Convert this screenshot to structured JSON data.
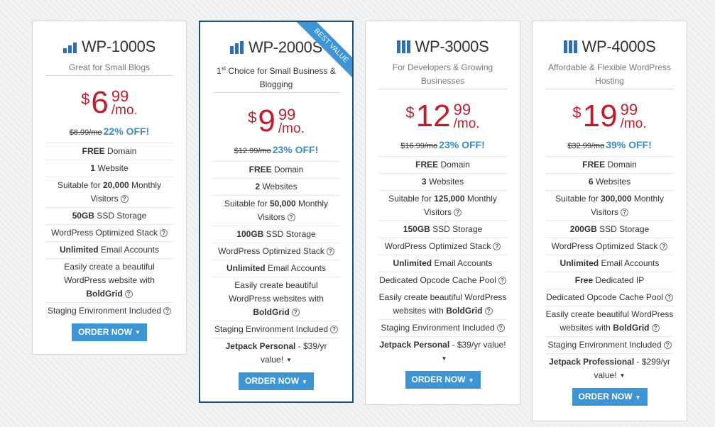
{
  "plans": [
    {
      "name": "WP-1000S",
      "bars": 2,
      "tagline": "Great for Small Blogs",
      "currency": "$",
      "price_whole": "6",
      "price_cents": "99",
      "price_per": "/mo.",
      "old_price": "$8.99/mo",
      "discount": "22% OFF!",
      "features": [
        {
          "strong": "FREE",
          "text": " Domain",
          "help": false
        },
        {
          "strong": "1",
          "text": " Website",
          "help": false
        },
        {
          "pre": "Suitable for ",
          "strong": "20,000",
          "text": " Monthly Visitors",
          "help": true
        },
        {
          "strong": "50GB",
          "text": " SSD Storage",
          "help": false
        },
        {
          "text": "WordPress Optimized Stack",
          "help": true
        },
        {
          "strong": "Unlimited",
          "text": " Email Accounts",
          "help": false
        },
        {
          "pre": "Easily create a beautiful WordPress website with ",
          "strong": "BoldGrid",
          "help": true
        },
        {
          "text": "Staging Environment Included",
          "help": true
        }
      ],
      "order_label": "ORDER NOW"
    },
    {
      "name": "WP-2000S",
      "bars": 3,
      "ribbon": "BEST VALUE",
      "tagline_sup": "st",
      "tagline_pre": "1",
      "tagline": " Choice for Small Business & Blogging",
      "currency": "$",
      "price_whole": "9",
      "price_cents": "99",
      "price_per": "/mo.",
      "old_price": "$12.99/mo",
      "discount": "23% OFF!",
      "features": [
        {
          "strong": "FREE",
          "text": " Domain",
          "help": false
        },
        {
          "strong": "2",
          "text": " Websites",
          "help": false
        },
        {
          "pre": "Suitable for ",
          "strong": "50,000",
          "text": " Monthly Visitors",
          "help": true
        },
        {
          "strong": "100GB",
          "text": " SSD Storage",
          "help": false
        },
        {
          "text": "WordPress Optimized Stack",
          "help": true
        },
        {
          "strong": "Unlimited",
          "text": " Email Accounts",
          "help": false
        },
        {
          "pre": "Easily create beautiful WordPress websites with ",
          "strong": "BoldGrid",
          "help": true
        },
        {
          "text": "Staging Environment Included",
          "help": true
        },
        {
          "strong": "Jetpack Personal",
          "text": " - $39/yr value!",
          "dropdown": true
        }
      ],
      "order_label": "ORDER NOW"
    },
    {
      "name": "WP-3000S",
      "bars": 4,
      "tagline": "For Developers & Growing Businesses",
      "currency": "$",
      "price_whole": "12",
      "price_cents": "99",
      "price_per": "/mo.",
      "old_price": "$16.99/mo",
      "discount": "23% OFF!",
      "features": [
        {
          "strong": "FREE",
          "text": " Domain",
          "help": false
        },
        {
          "strong": "3",
          "text": " Websites",
          "help": false
        },
        {
          "pre": "Suitable for ",
          "strong": "125,000",
          "text": " Monthly Visitors",
          "help": true
        },
        {
          "strong": "150GB",
          "text": " SSD Storage",
          "help": false
        },
        {
          "text": "WordPress Optimized Stack",
          "help": true
        },
        {
          "strong": "Unlimited",
          "text": " Email Accounts",
          "help": false
        },
        {
          "text": "Dedicated Opcode Cache Pool",
          "help": true
        },
        {
          "pre": "Easily create beautiful WordPress websites with ",
          "strong": "BoldGrid",
          "help": true
        },
        {
          "text": "Staging Environment Included",
          "help": true
        },
        {
          "strong": "Jetpack Personal",
          "text": " - $39/yr value!",
          "dropdown": true
        }
      ],
      "order_label": "ORDER NOW"
    },
    {
      "name": "WP-4000S",
      "bars": 4,
      "tagline": "Affordable & Flexible WordPress Hosting",
      "currency": "$",
      "price_whole": "19",
      "price_cents": "99",
      "price_per": "/mo.",
      "old_price": "$32.99/mo",
      "discount": "39% OFF!",
      "features": [
        {
          "strong": "FREE",
          "text": " Domain",
          "help": false
        },
        {
          "strong": "6",
          "text": " Websites",
          "help": false
        },
        {
          "pre": "Suitable for ",
          "strong": "300,000",
          "text": " Monthly Visitors",
          "help": true
        },
        {
          "strong": "200GB",
          "text": " SSD Storage",
          "help": false
        },
        {
          "text": "WordPress Optimized Stack",
          "help": true
        },
        {
          "strong": "Unlimited",
          "text": " Email Accounts",
          "help": false
        },
        {
          "strong": "Free",
          "text": " Dedicated IP",
          "help": false
        },
        {
          "text": "Dedicated Opcode Cache Pool",
          "help": true
        },
        {
          "pre": "Easily create beautiful WordPress websites with ",
          "strong": "BoldGrid",
          "help": true
        },
        {
          "text": "Staging Environment Included",
          "help": true
        },
        {
          "strong": "Jetpack Professional",
          "text": " - $299/yr value!",
          "dropdown": true
        }
      ],
      "order_label": "ORDER NOW"
    }
  ]
}
